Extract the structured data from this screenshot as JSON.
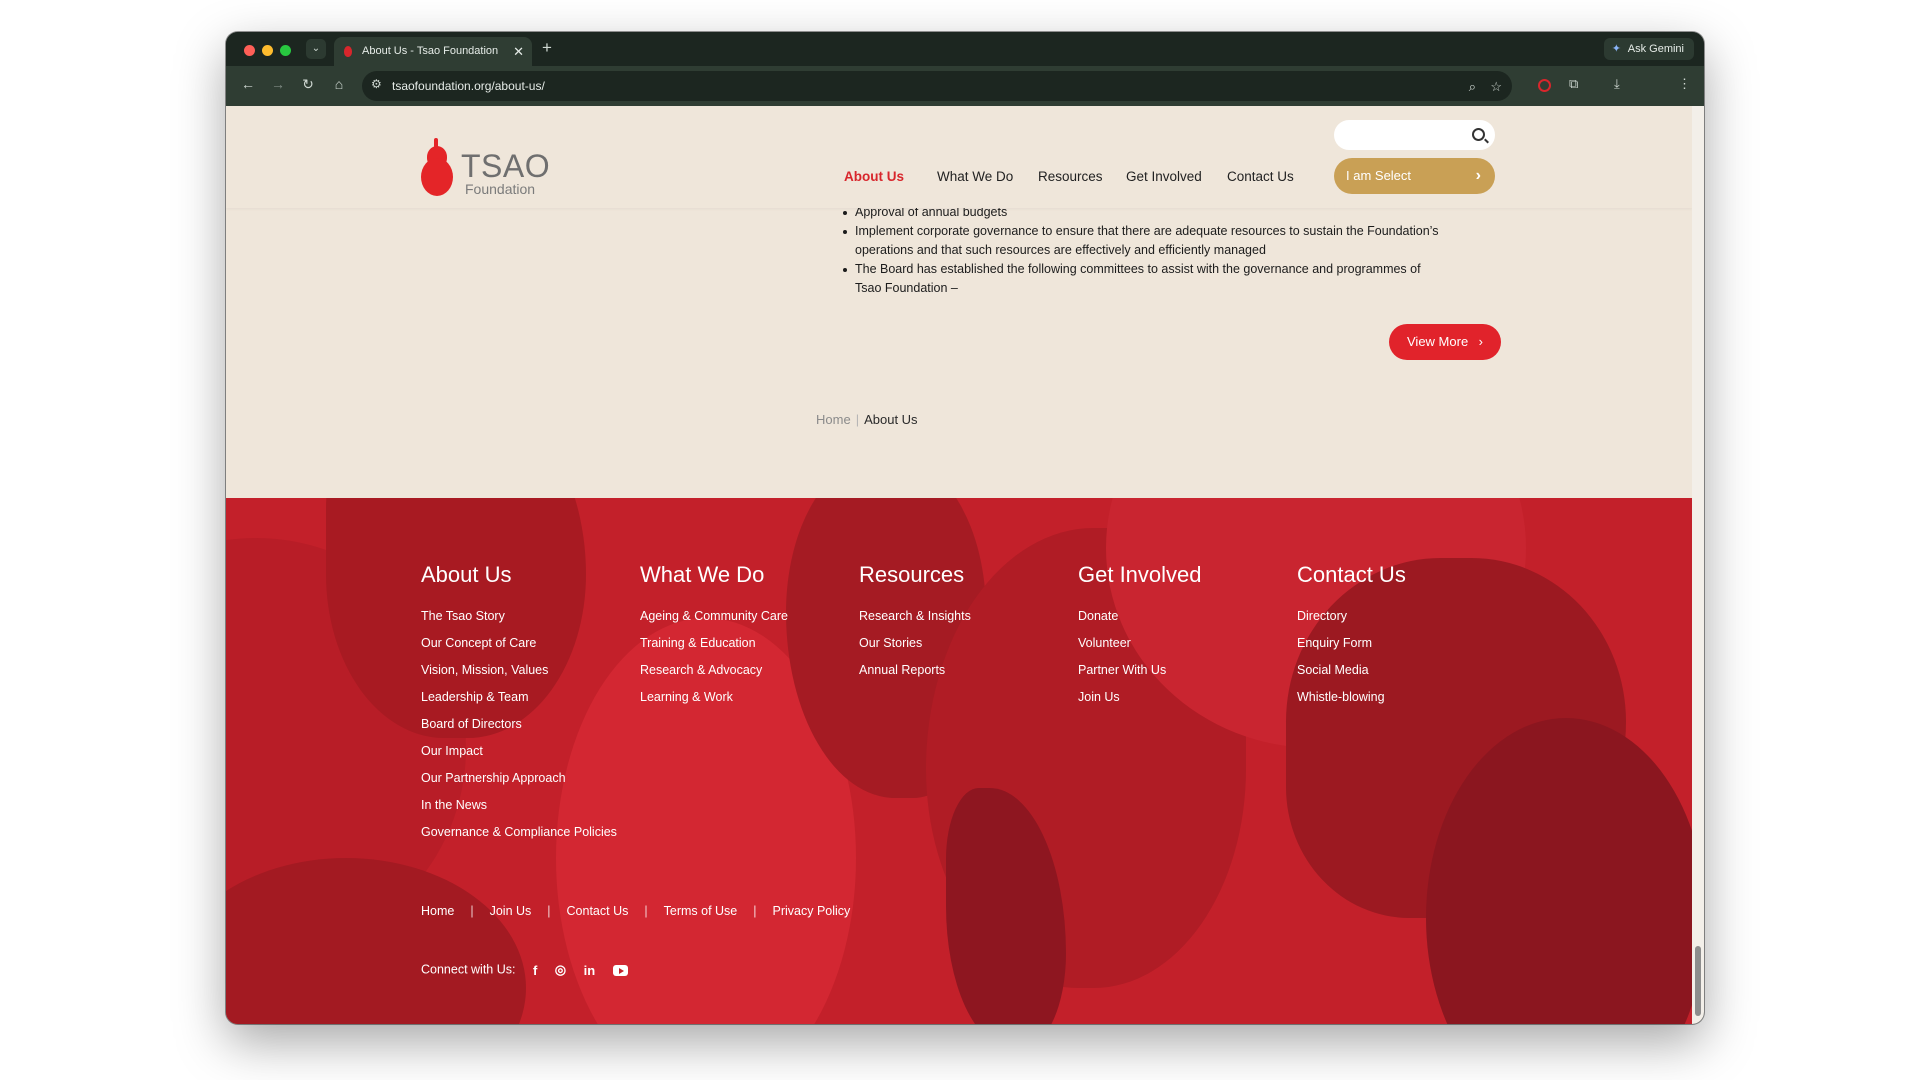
{
  "browser": {
    "tab_title": "About Us - Tsao Foundation",
    "tab_close": "✕",
    "new_tab": "+",
    "ask_gemini": "Ask Gemini",
    "url": "tsaofoundation.org/about-us/"
  },
  "header": {
    "logo_title": "TSAO",
    "logo_subtitle": "Foundation",
    "search_placeholder": "",
    "nav": [
      "About Us",
      "What We Do",
      "Resources",
      "Get Involved",
      "Contact Us"
    ],
    "select_label": "I am Select"
  },
  "content": {
    "bullets": [
      "Approval of annual budgets",
      "Implement corporate governance to ensure that there are adequate resources to sustain the Foundation’s operations and that such resources are effectively and efficiently managed",
      "The Board has established the following committees to assist with the governance and programmes of Tsao Foundation –"
    ],
    "view_more": "View More",
    "breadcrumb": {
      "home": "Home",
      "separator": "|",
      "current": "About Us"
    }
  },
  "footer": {
    "columns": [
      {
        "title": "About Us",
        "links": [
          "The Tsao Story",
          "Our Concept of Care",
          "Vision, Mission, Values",
          "Leadership & Team",
          "Board of Directors",
          "Our Impact",
          "Our Partnership Approach",
          "In the News",
          "Governance & Compliance Policies"
        ]
      },
      {
        "title": "What We Do",
        "links": [
          "Ageing & Community Care",
          "Training & Education",
          "Research & Advocacy",
          "Learning & Work"
        ]
      },
      {
        "title": "Resources",
        "links": [
          "Research & Insights",
          "Our Stories",
          "Annual Reports"
        ]
      },
      {
        "title": "Get Involved",
        "links": [
          "Donate",
          "Volunteer",
          "Partner With Us",
          "Join Us"
        ]
      },
      {
        "title": "Contact Us",
        "links": [
          "Directory",
          "Enquiry Form",
          "Social Media",
          "Whistle-blowing"
        ]
      }
    ],
    "bottom_links": [
      "Home",
      "Join Us",
      "Contact Us",
      "Terms of Use",
      "Privacy Policy"
    ],
    "bottom_separator": "|",
    "connect_label": "Connect with Us:",
    "social": {
      "facebook": "f",
      "instagram": "◎",
      "linkedin": "in"
    }
  },
  "colors": {
    "brand_red": "#e1232b",
    "footer_red": "#c3202a",
    "gold": "#c9a055",
    "page_bg": "#efe6da"
  }
}
